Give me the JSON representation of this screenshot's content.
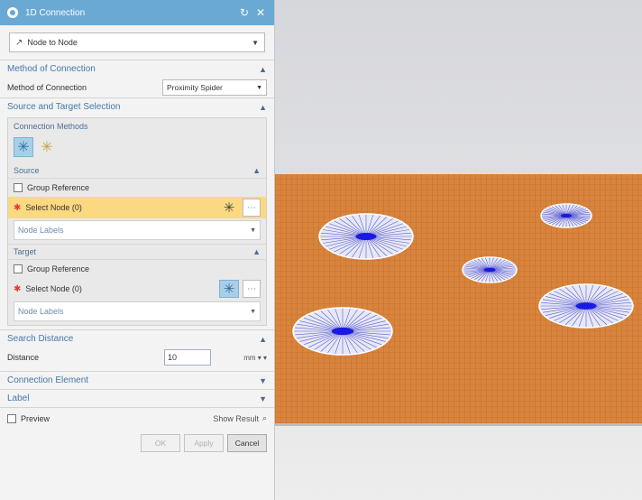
{
  "dialog": {
    "title": "1D Connection",
    "refresh_icon": "refresh-icon",
    "close_icon": "close-icon",
    "connection_type": "Node to Node",
    "method_section": {
      "header": "Method of Connection",
      "label": "Method of Connection",
      "value": "Proximity Spider"
    },
    "source_target_section": {
      "header": "Source and Target Selection",
      "connection_methods_label": "Connection Methods",
      "source": {
        "header": "Source",
        "group_reference": "Group Reference",
        "select_node": "Select Node (0)",
        "node_labels": "Node Labels"
      },
      "target": {
        "header": "Target",
        "group_reference": "Group Reference",
        "select_node": "Select Node (0)",
        "node_labels": "Node Labels"
      }
    },
    "search_distance_section": {
      "header": "Search Distance",
      "label": "Distance",
      "value": "10",
      "unit": "mm"
    },
    "connection_element_header": "Connection Element",
    "label_header": "Label",
    "preview_label": "Preview",
    "show_result_label": "Show Result",
    "buttons": {
      "ok": "OK",
      "apply": "Apply",
      "cancel": "Cancel"
    },
    "colors": {
      "titlebar": "#6aa9d3",
      "highlight": "#fbd981",
      "section_text": "#4477aa"
    }
  },
  "viewport": {
    "colors": {
      "mesh": "#d9843c",
      "mesh_lines": "#b5652a",
      "spider_fill": "#e6e8f7",
      "spider_lines": "#5a5ccf",
      "spider_center": "#1a1adf"
    }
  }
}
